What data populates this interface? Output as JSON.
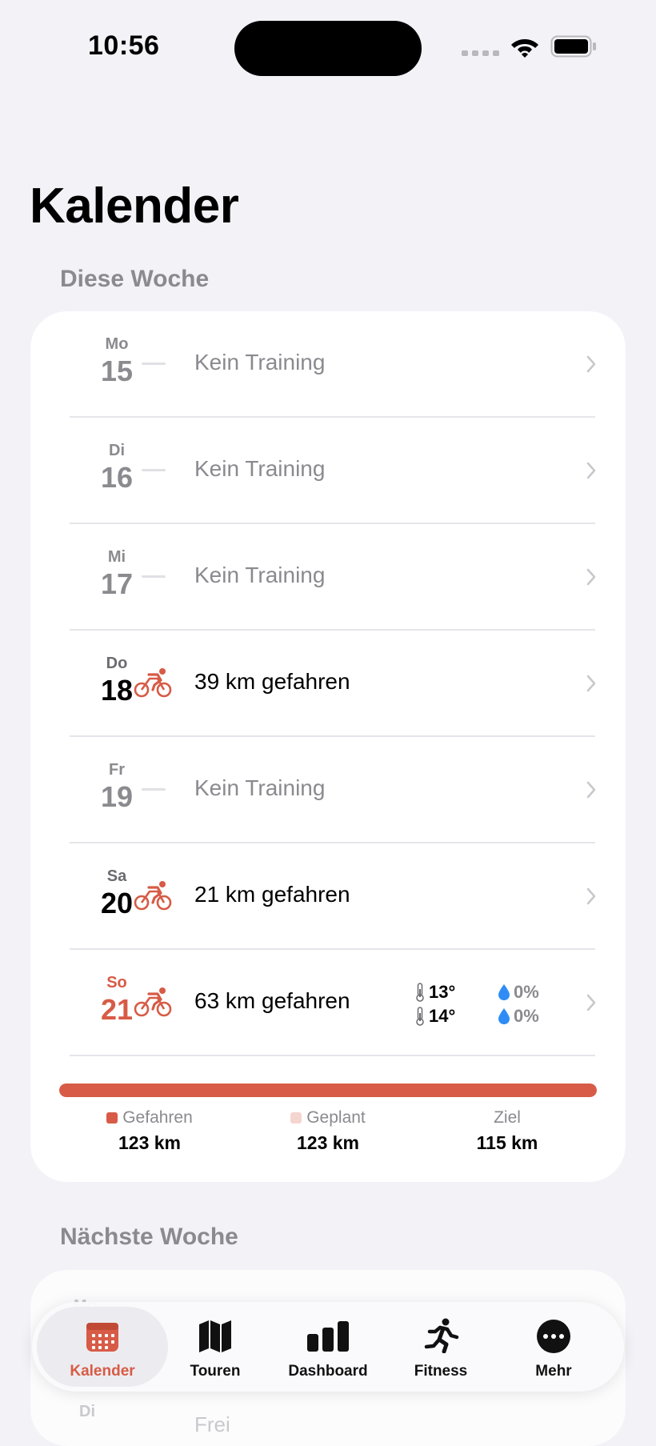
{
  "status": {
    "time": "10:56"
  },
  "page": {
    "title": "Kalender"
  },
  "this_week": {
    "label": "Diese Woche",
    "days": [
      {
        "abbr": "Mo",
        "num": "15",
        "activity": "Kein Training"
      },
      {
        "abbr": "Di",
        "num": "16",
        "activity": "Kein Training"
      },
      {
        "abbr": "Mi",
        "num": "17",
        "activity": "Kein Training"
      },
      {
        "abbr": "Do",
        "num": "18",
        "activity": "39 km gefahren",
        "icon": "bike-icon"
      },
      {
        "abbr": "Fr",
        "num": "19",
        "activity": "Kein Training"
      },
      {
        "abbr": "Sa",
        "num": "20",
        "activity": "21 km gefahren",
        "icon": "bike-icon"
      },
      {
        "abbr": "So",
        "num": "21",
        "activity": "63 km gefahren",
        "icon": "bike-icon",
        "weather": {
          "temp_1": "13°",
          "temp_2": "14°",
          "rain_1": "0%",
          "rain_2": "0%"
        }
      }
    ],
    "progress": {
      "driven_fraction": 1.0
    },
    "legend": {
      "driven_label": "Gefahren",
      "driven_value": "123 km",
      "planned_label": "Geplant",
      "planned_value": "123 km",
      "goal_label": "Ziel",
      "goal_value": "115 km"
    }
  },
  "next_week": {
    "label": "Nächste Woche",
    "first_day_abbr": "Mo",
    "second_day_abbr": "Di",
    "second_day_text": "Frei"
  },
  "tabbar": {
    "tabs": [
      {
        "label": "Kalender",
        "icon": "calendar-icon",
        "selected": true
      },
      {
        "label": "Touren",
        "icon": "map-icon"
      },
      {
        "label": "Dashboard",
        "icon": "bar-chart-icon"
      },
      {
        "label": "Fitness",
        "icon": "running-figure-icon"
      },
      {
        "label": "Mehr",
        "icon": "more-icon"
      }
    ]
  },
  "colors": {
    "accent": "#d75b46",
    "accent_light": "#f5d5cf",
    "background": "#f2f2f7"
  }
}
